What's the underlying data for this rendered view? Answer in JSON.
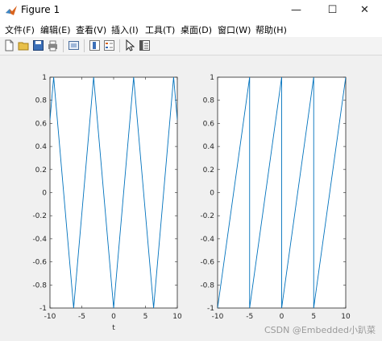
{
  "window": {
    "title": "Figure 1",
    "minimize_glyph": "—",
    "maximize_glyph": "☐",
    "close_glyph": "✕"
  },
  "menu": [
    {
      "label": "文件(F)"
    },
    {
      "label": "编辑(E)"
    },
    {
      "label": "查看(V)"
    },
    {
      "label": "插入(I)"
    },
    {
      "label": "工具(T)"
    },
    {
      "label": "桌面(D)"
    },
    {
      "label": "窗口(W)"
    },
    {
      "label": "帮助(H)"
    }
  ],
  "toolbar": {
    "icons": [
      "new-figure-icon",
      "open-file-icon",
      "save-icon",
      "print-icon",
      "link-plot-icon",
      "insert-colorbar-icon",
      "insert-legend-icon",
      "edit-plot-icon",
      "property-inspector-icon"
    ]
  },
  "colors": {
    "line": "#0072BD",
    "axes": "#262626"
  },
  "watermark": "CSDN @Embedded小趴菜",
  "chart_data": [
    {
      "type": "line",
      "title": "",
      "xlabel": "t",
      "ylabel": "",
      "xlim": [
        -10,
        10
      ],
      "ylim": [
        -1,
        1
      ],
      "x_ticks": [
        "-10",
        "-5",
        "0",
        "5",
        "10"
      ],
      "y_ticks": [
        "-1",
        "-0.8",
        "-0.6",
        "-0.4",
        "-0.2",
        "0",
        "0.2",
        "0.4",
        "0.6",
        "0.8",
        "1"
      ],
      "series": [
        {
          "x": [
            -10,
            -9.42,
            -6.28,
            -3.14,
            0,
            3.14,
            6.28,
            9.42,
            10
          ],
          "y": [
            0.63,
            1,
            -1,
            1,
            -1,
            1,
            -1,
            1,
            0.63
          ]
        }
      ]
    },
    {
      "type": "line",
      "title": "",
      "xlabel": "",
      "ylabel": "",
      "xlim": [
        -10,
        10
      ],
      "ylim": [
        -1,
        1
      ],
      "x_ticks": [
        "-10",
        "-5",
        "0",
        "5",
        "10"
      ],
      "y_ticks": [
        "-1",
        "-0.8",
        "-0.6",
        "-0.4",
        "-0.2",
        "0",
        "0.2",
        "0.4",
        "0.6",
        "0.8",
        "1"
      ],
      "series": [
        {
          "x": [
            -10,
            -5,
            -5,
            0,
            0,
            5,
            5,
            10
          ],
          "y": [
            -1,
            1,
            -1,
            1,
            -1,
            1,
            -1,
            1
          ]
        }
      ]
    }
  ]
}
